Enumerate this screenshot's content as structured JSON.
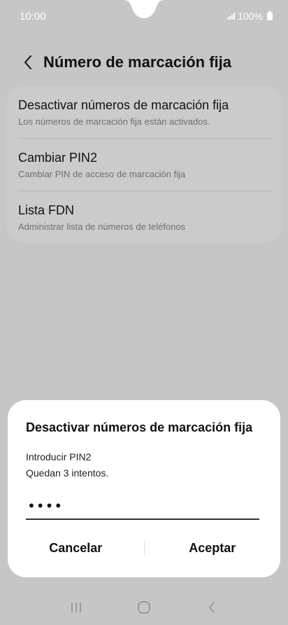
{
  "status_bar": {
    "time": "10:00",
    "battery": "100%"
  },
  "header": {
    "title": "Número de marcación fija"
  },
  "settings": {
    "items": [
      {
        "title": "Desactivar números de marcación fija",
        "subtitle": "Los números de marcación fija están activados."
      },
      {
        "title": "Cambiar PIN2",
        "subtitle": "Cambiar PIN de acceso de marcación fija"
      },
      {
        "title": "Lista FDN",
        "subtitle": "Administrar lista de números de teléfonos"
      }
    ]
  },
  "dialog": {
    "title": "Desactivar números de marcación fija",
    "message_line1": "Introducir PIN2",
    "message_line2": "Quedan 3 intentos.",
    "pin_value": "••••",
    "cancel_label": "Cancelar",
    "accept_label": "Aceptar"
  },
  "icons": {
    "back": "back-arrow-icon",
    "recents": "recents-icon",
    "home": "home-icon",
    "nav_back": "nav-back-icon"
  },
  "colors": {
    "background_dimmed": "#c6c6c6",
    "dialog_bg": "#ffffff"
  }
}
